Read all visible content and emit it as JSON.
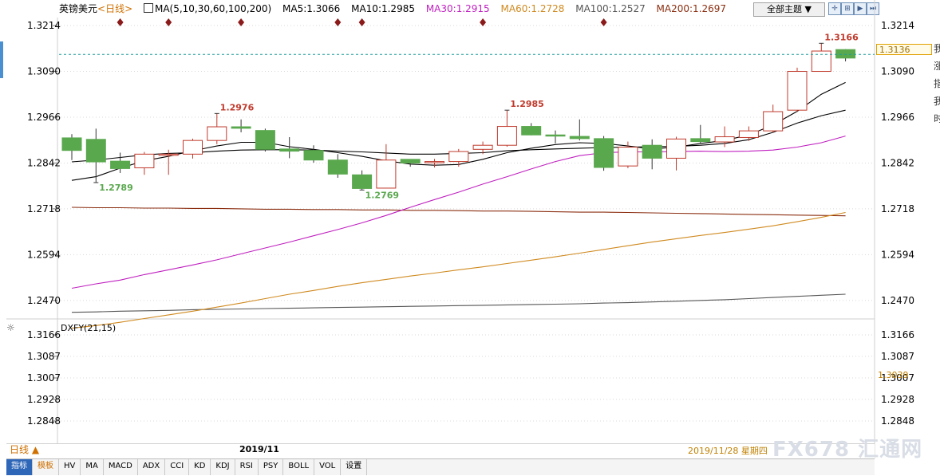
{
  "header": {
    "symbol": "英镑美元",
    "period": "<日线>",
    "ma_params": "MA(5,10,30,60,100,200)",
    "ma5": "MA5:1.3066",
    "ma10": "MA10:1.2985",
    "ma30": "MA30:1.2915",
    "ma60": "MA60:1.2728",
    "ma100": "MA100:1.2527",
    "ma200": "MA200:1.2697",
    "theme_select": "全部主题"
  },
  "colors": {
    "up": "#c0392b",
    "down": "#5aa84e",
    "ma5": "#000000",
    "ma10": "#000000",
    "ma30": "#c020c0",
    "ma60": "#d08a20",
    "ma100": "#555555",
    "ma200": "#8b2e10",
    "grid": "#d9d9d9",
    "dotted_price": "#1a9c9c"
  },
  "price_axis": {
    "ticks": [
      "1.3214",
      "1.3090",
      "1.2966",
      "1.2842",
      "1.2718",
      "1.2594",
      "1.2470"
    ],
    "current_price": "1.3136"
  },
  "indicator": {
    "name": "DXFY(21,15)",
    "ticks": [
      "1.3166",
      "1.3087",
      "1.3007",
      "1.2928",
      "1.2848"
    ],
    "value": "1.3039"
  },
  "bottom": {
    "period_button": "日线 ▲",
    "month_label": "2019/11",
    "current_date": "2019/11/28 星期四",
    "watermark": "FX678 汇通网"
  },
  "tabs": [
    "指标",
    "模板",
    "HV",
    "MA",
    "MACD",
    "ADX",
    "CCI",
    "KD",
    "KDJ",
    "RSI",
    "PSY",
    "BOLL",
    "VOL",
    "设置"
  ],
  "side_glyphs": [
    "我",
    "涨",
    "指",
    "我",
    "时"
  ],
  "annotations": [
    {
      "label": "1.2789",
      "color": "#5aa84e"
    },
    {
      "label": "1.2976",
      "color": "#c0392b"
    },
    {
      "label": "1.2769",
      "color": "#5aa84e"
    },
    {
      "label": "1.2985",
      "color": "#c0392b"
    },
    {
      "label": "1.3166",
      "color": "#c0392b"
    }
  ],
  "chart_data": {
    "type": "candlestick",
    "title": "英镑美元<日线>",
    "ylim": [
      1.242,
      1.324
    ],
    "candles": [
      {
        "o": 1.291,
        "h": 1.292,
        "l": 1.285,
        "c": 1.2876
      },
      {
        "o": 1.2906,
        "h": 1.2935,
        "l": 1.2789,
        "c": 1.2845
      },
      {
        "o": 1.2847,
        "h": 1.287,
        "l": 1.2815,
        "c": 1.2827
      },
      {
        "o": 1.2829,
        "h": 1.2872,
        "l": 1.281,
        "c": 1.2866
      },
      {
        "o": 1.2866,
        "h": 1.2878,
        "l": 1.281,
        "c": 1.2866
      },
      {
        "o": 1.2866,
        "h": 1.2908,
        "l": 1.2854,
        "c": 1.2903
      },
      {
        "o": 1.2903,
        "h": 1.2976,
        "l": 1.2893,
        "c": 1.294
      },
      {
        "o": 1.294,
        "h": 1.296,
        "l": 1.2925,
        "c": 1.2936
      },
      {
        "o": 1.293,
        "h": 1.2935,
        "l": 1.2873,
        "c": 1.2879
      },
      {
        "o": 1.288,
        "h": 1.2912,
        "l": 1.2855,
        "c": 1.2874
      },
      {
        "o": 1.2876,
        "h": 1.289,
        "l": 1.2843,
        "c": 1.285
      },
      {
        "o": 1.285,
        "h": 1.2866,
        "l": 1.2802,
        "c": 1.2812
      },
      {
        "o": 1.281,
        "h": 1.2822,
        "l": 1.2769,
        "c": 1.2773
      },
      {
        "o": 1.2774,
        "h": 1.2893,
        "l": 1.2774,
        "c": 1.285
      },
      {
        "o": 1.2852,
        "h": 1.2852,
        "l": 1.2832,
        "c": 1.2842
      },
      {
        "o": 1.2845,
        "h": 1.2853,
        "l": 1.283,
        "c": 1.2846
      },
      {
        "o": 1.2846,
        "h": 1.288,
        "l": 1.2832,
        "c": 1.2873
      },
      {
        "o": 1.2879,
        "h": 1.29,
        "l": 1.2866,
        "c": 1.289
      },
      {
        "o": 1.289,
        "h": 1.2985,
        "l": 1.2886,
        "c": 1.2941
      },
      {
        "o": 1.2941,
        "h": 1.295,
        "l": 1.2917,
        "c": 1.2918
      },
      {
        "o": 1.2918,
        "h": 1.293,
        "l": 1.2895,
        "c": 1.2915
      },
      {
        "o": 1.2914,
        "h": 1.296,
        "l": 1.2903,
        "c": 1.2908
      },
      {
        "o": 1.2908,
        "h": 1.2915,
        "l": 1.2821,
        "c": 1.283
      },
      {
        "o": 1.2834,
        "h": 1.29,
        "l": 1.2828,
        "c": 1.2885
      },
      {
        "o": 1.289,
        "h": 1.2906,
        "l": 1.2825,
        "c": 1.2855
      },
      {
        "o": 1.2855,
        "h": 1.2913,
        "l": 1.2822,
        "c": 1.2907
      },
      {
        "o": 1.2908,
        "h": 1.2945,
        "l": 1.2895,
        "c": 1.29
      },
      {
        "o": 1.2899,
        "h": 1.2941,
        "l": 1.2885,
        "c": 1.2913
      },
      {
        "o": 1.2911,
        "h": 1.2941,
        "l": 1.2902,
        "c": 1.2929
      },
      {
        "o": 1.2929,
        "h": 1.3,
        "l": 1.2925,
        "c": 1.2981
      },
      {
        "o": 1.2985,
        "h": 1.31,
        "l": 1.298,
        "c": 1.309
      },
      {
        "o": 1.309,
        "h": 1.3166,
        "l": 1.309,
        "c": 1.3145
      },
      {
        "o": 1.3149,
        "h": 1.315,
        "l": 1.3117,
        "c": 1.3126
      }
    ],
    "ma5": [
      1.2795,
      1.2805,
      1.2828,
      1.2848,
      1.286,
      1.2875,
      1.2888,
      1.2898,
      1.2898,
      1.2886,
      1.2879,
      1.287,
      1.286,
      1.2848,
      1.2839,
      1.2836,
      1.2838,
      1.2852,
      1.287,
      1.2882,
      1.2892,
      1.2897,
      1.2895,
      1.2888,
      1.288,
      1.2885,
      1.2895,
      1.2903,
      1.2918,
      1.2945,
      1.2982,
      1.3028,
      1.306
    ],
    "ma10": [
      1.2845,
      1.285,
      1.2857,
      1.2864,
      1.2868,
      1.287,
      1.2874,
      1.2877,
      1.2878,
      1.2878,
      1.2877,
      1.2874,
      1.2872,
      1.2869,
      1.2866,
      1.2866,
      1.2868,
      1.287,
      1.2875,
      1.2878,
      1.288,
      1.2882,
      1.2884,
      1.2885,
      1.2886,
      1.2887,
      1.289,
      1.2895,
      1.2905,
      1.2925,
      1.295,
      1.297,
      1.2985
    ],
    "ma30": [
      1.2503,
      1.2515,
      1.2525,
      1.254,
      1.2553,
      1.2566,
      1.258,
      1.2596,
      1.2612,
      1.2628,
      1.2645,
      1.2662,
      1.268,
      1.27,
      1.2722,
      1.2743,
      1.2763,
      1.2785,
      1.2805,
      1.2826,
      1.2846,
      1.2862,
      1.287,
      1.2872,
      1.2872,
      1.2873,
      1.2874,
      1.2873,
      1.2874,
      1.2877,
      1.2885,
      1.2897,
      1.2915
    ],
    "ma60": [
      1.2395,
      1.2402,
      1.2411,
      1.2421,
      1.2431,
      1.2441,
      1.2452,
      1.2463,
      1.2475,
      1.2487,
      1.2497,
      1.2508,
      1.2518,
      1.2527,
      1.2536,
      1.2544,
      1.2553,
      1.2561,
      1.257,
      1.2579,
      1.2588,
      1.2598,
      1.2608,
      1.2618,
      1.2628,
      1.2637,
      1.2646,
      1.2654,
      1.2663,
      1.2672,
      1.2683,
      1.2695,
      1.2708
    ],
    "ma100": [
      1.2438,
      1.2439,
      1.2441,
      1.2442,
      1.2443,
      1.2445,
      1.2446,
      1.2447,
      1.2448,
      1.2449,
      1.245,
      1.2451,
      1.2452,
      1.2453,
      1.2454,
      1.2455,
      1.2456,
      1.2457,
      1.2458,
      1.2459,
      1.246,
      1.2461,
      1.2463,
      1.2464,
      1.2466,
      1.2468,
      1.247,
      1.2472,
      1.2475,
      1.2478,
      1.2481,
      1.2484,
      1.2487
    ],
    "ma200": [
      1.2722,
      1.2721,
      1.2721,
      1.272,
      1.272,
      1.2719,
      1.2719,
      1.2718,
      1.2717,
      1.2717,
      1.2716,
      1.2716,
      1.2715,
      1.2715,
      1.2714,
      1.2714,
      1.2713,
      1.2712,
      1.2712,
      1.2711,
      1.271,
      1.2709,
      1.2709,
      1.2708,
      1.2707,
      1.2706,
      1.2705,
      1.2704,
      1.2703,
      1.2702,
      1.2701,
      1.27,
      1.2699
    ],
    "current_price": 1.3136,
    "markers_at": [
      2,
      4,
      7,
      11,
      12,
      17,
      22
    ]
  }
}
